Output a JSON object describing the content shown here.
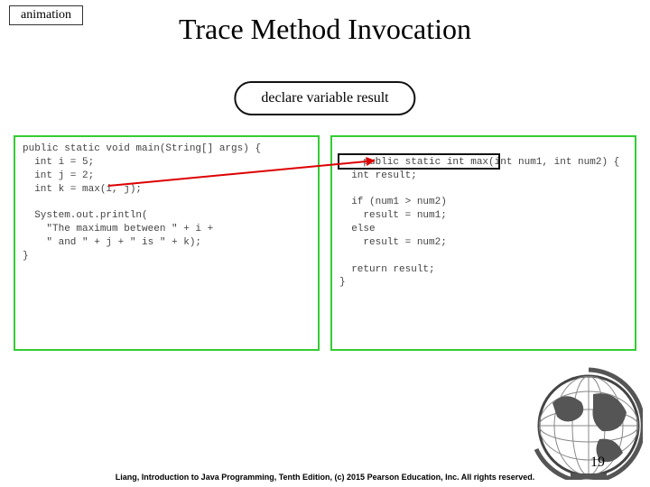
{
  "badge": "animation",
  "title": "Trace Method Invocation",
  "callout": "declare variable result",
  "left_code": "public static void main(String[] args) {\n  int i = 5;\n  int j = 2;\n  int k = max(i, j);\n\n  System.out.println(\n    \"The maximum between \" + i +\n    \" and \" + j + \" is \" + k);\n}",
  "right_code": "public static int max(int num1, int num2) {\n  int result;\n\n  if (num1 > num2)\n    result = num1;\n  else\n    result = num2;\n\n  return result;\n}",
  "footer": "Liang, Introduction to Java Programming, Tenth Edition, (c) 2015 Pearson Education, Inc. All rights reserved.",
  "page_number": "19"
}
